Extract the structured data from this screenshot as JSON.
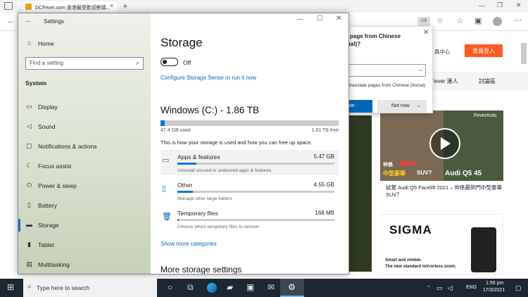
{
  "browser": {
    "tab_title": "DCFever.com 香港最受歡迎數碼...",
    "tab_close": "×",
    "new_tab": "+",
    "back_glyph": "←",
    "reader_badge": "GB",
    "site": {
      "member_center": "員中心",
      "login": "會員登入",
      "nav_a": "Fever 達人",
      "nav_b": "討論區",
      "video_brand": "FeverAuto",
      "video_overlay_top": "仲係",
      "video_overlay_mid": "最熱門",
      "video_overlay_bot": "中型豪華",
      "video_overlay_suv": "SUV?",
      "video_car": "Audi Q5 45",
      "caption": "試駕 Audi Q5 Facelift 2021 – 仲係最熱門中型豪華 SUV？",
      "ad_brand": "SIGMA",
      "ad_tag1": "Smart and nimble.",
      "ad_tag2": "The new standard mirrorless zoom."
    }
  },
  "translate": {
    "title_line1": "page from Chinese",
    "title_line2": "nal)?",
    "select_value": "",
    "checkbox_text": "s translate pages from Chinese (itional)",
    "translate_button": "slate",
    "not_now_button": "Not now"
  },
  "settings": {
    "window_title": "Settings",
    "min_glyph": "—",
    "max_glyph": "☐",
    "close_glyph": "✕",
    "nav": {
      "home": "Home",
      "search_placeholder": "Find a setting",
      "section": "System",
      "items": [
        {
          "label": "Display",
          "icon": "display-icon"
        },
        {
          "label": "Sound",
          "icon": "sound-icon"
        },
        {
          "label": "Notifications & actions",
          "icon": "notifications-icon"
        },
        {
          "label": "Focus assist",
          "icon": "focus-assist-icon"
        },
        {
          "label": "Power & sleep",
          "icon": "power-icon"
        },
        {
          "label": "Battery",
          "icon": "battery-icon"
        },
        {
          "label": "Storage",
          "icon": "storage-icon"
        },
        {
          "label": "Tablet",
          "icon": "tablet-icon"
        },
        {
          "label": "Multitasking",
          "icon": "multitasking-icon"
        }
      ],
      "selected": "Storage"
    },
    "main": {
      "page_title": "Storage",
      "toggle_state": "Off",
      "configure_link": "Configure Storage Sense or run it now",
      "drive_title": "Windows (C:) - 1.86 TB",
      "used_label": "47.4 GB used",
      "free_label": "1.81 TB free",
      "used_fraction": 0.025,
      "intro": "This is how your storage is used and how you can free up space.",
      "categories": [
        {
          "name": "Apps & features",
          "size": "5.47 GB",
          "desc": "Uninstall unused or undesired apps & features",
          "fill": 0.12
        },
        {
          "name": "Other",
          "size": "4.55 GB",
          "desc": "Manage other large folders",
          "fill": 0.1
        },
        {
          "name": "Temporary files",
          "size": "168 MB",
          "desc": "Choose which temporary files to remove",
          "fill": 0.01
        }
      ],
      "show_more": "Show more categories",
      "more_settings": "More storage settings"
    }
  },
  "taskbar": {
    "search_placeholder": "Type here to search",
    "lang": "ENG",
    "time": "1:56 pm",
    "date": "17/3/2021"
  },
  "colors": {
    "accent": "#0078d7",
    "taskbar": "#1c2731",
    "login_button": "#ff5a1f"
  }
}
